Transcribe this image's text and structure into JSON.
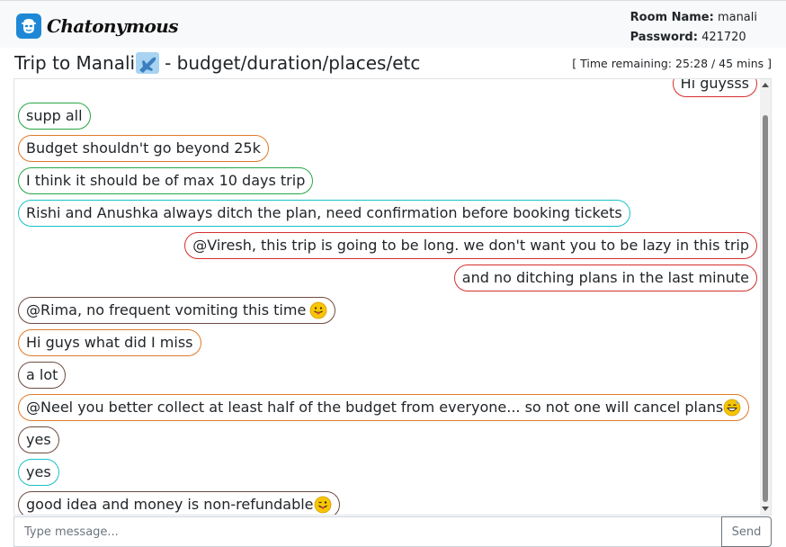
{
  "app": {
    "name": "Chatonymous"
  },
  "room": {
    "name_label": "Room Name:",
    "name": "manali",
    "password_label": "Password:",
    "password": "421720"
  },
  "chat": {
    "title_prefix": "Trip to Manali",
    "title_icon": "airplane-emoji",
    "title_suffix": " - budget/duration/places/etc",
    "timer": "[ Time remaining: 25:28 / 45 mins ]"
  },
  "colors": {
    "green": "#28a745",
    "orange": "#e07a2a",
    "teal": "#17c1c9",
    "red": "#d62f2f",
    "brown": "#6d4c41"
  },
  "messages": [
    {
      "text": "Hi guysss",
      "side": "right",
      "color": "#d62f2f"
    },
    {
      "text": "supp all",
      "side": "left",
      "color": "#28a745"
    },
    {
      "text": "Budget shouldn't go beyond 25k",
      "side": "left",
      "color": "#e07a2a"
    },
    {
      "text": "I think it should be of max 10 days trip",
      "side": "left",
      "color": "#28a745"
    },
    {
      "text": "Rishi and Anushka always ditch the plan, need confirmation before booking tickets",
      "side": "left",
      "color": "#17c1c9"
    },
    {
      "text": "@Viresh, this trip is going to be long. we don't want you to be lazy in this trip",
      "side": "right",
      "color": "#d62f2f"
    },
    {
      "text": "and no ditching plans in the last minute",
      "side": "right",
      "color": "#d62f2f"
    },
    {
      "text": "@Rima, no frequent vomiting this time",
      "emoji": "tongue-emoji",
      "side": "left",
      "color": "#6d4c41"
    },
    {
      "text": "Hi guys what did I miss",
      "side": "left",
      "color": "#e07a2a"
    },
    {
      "text": "a lot",
      "side": "left",
      "color": "#6d4c41"
    },
    {
      "text": "@Neel you better collect at least half of the budget from everyone... so not one will cancel plans",
      "emoji": "grin-sweat-emoji",
      "side": "left",
      "color": "#e07a2a"
    },
    {
      "text": "yes",
      "side": "left",
      "color": "#6d4c41"
    },
    {
      "text": "yes",
      "side": "left",
      "color": "#17c1c9"
    },
    {
      "text": "good idea and money is non-refundable",
      "emoji": "winking-tongue-emoji",
      "side": "left",
      "color": "#6d4c41"
    }
  ],
  "composer": {
    "placeholder": "Type message...",
    "send_label": "Send"
  }
}
